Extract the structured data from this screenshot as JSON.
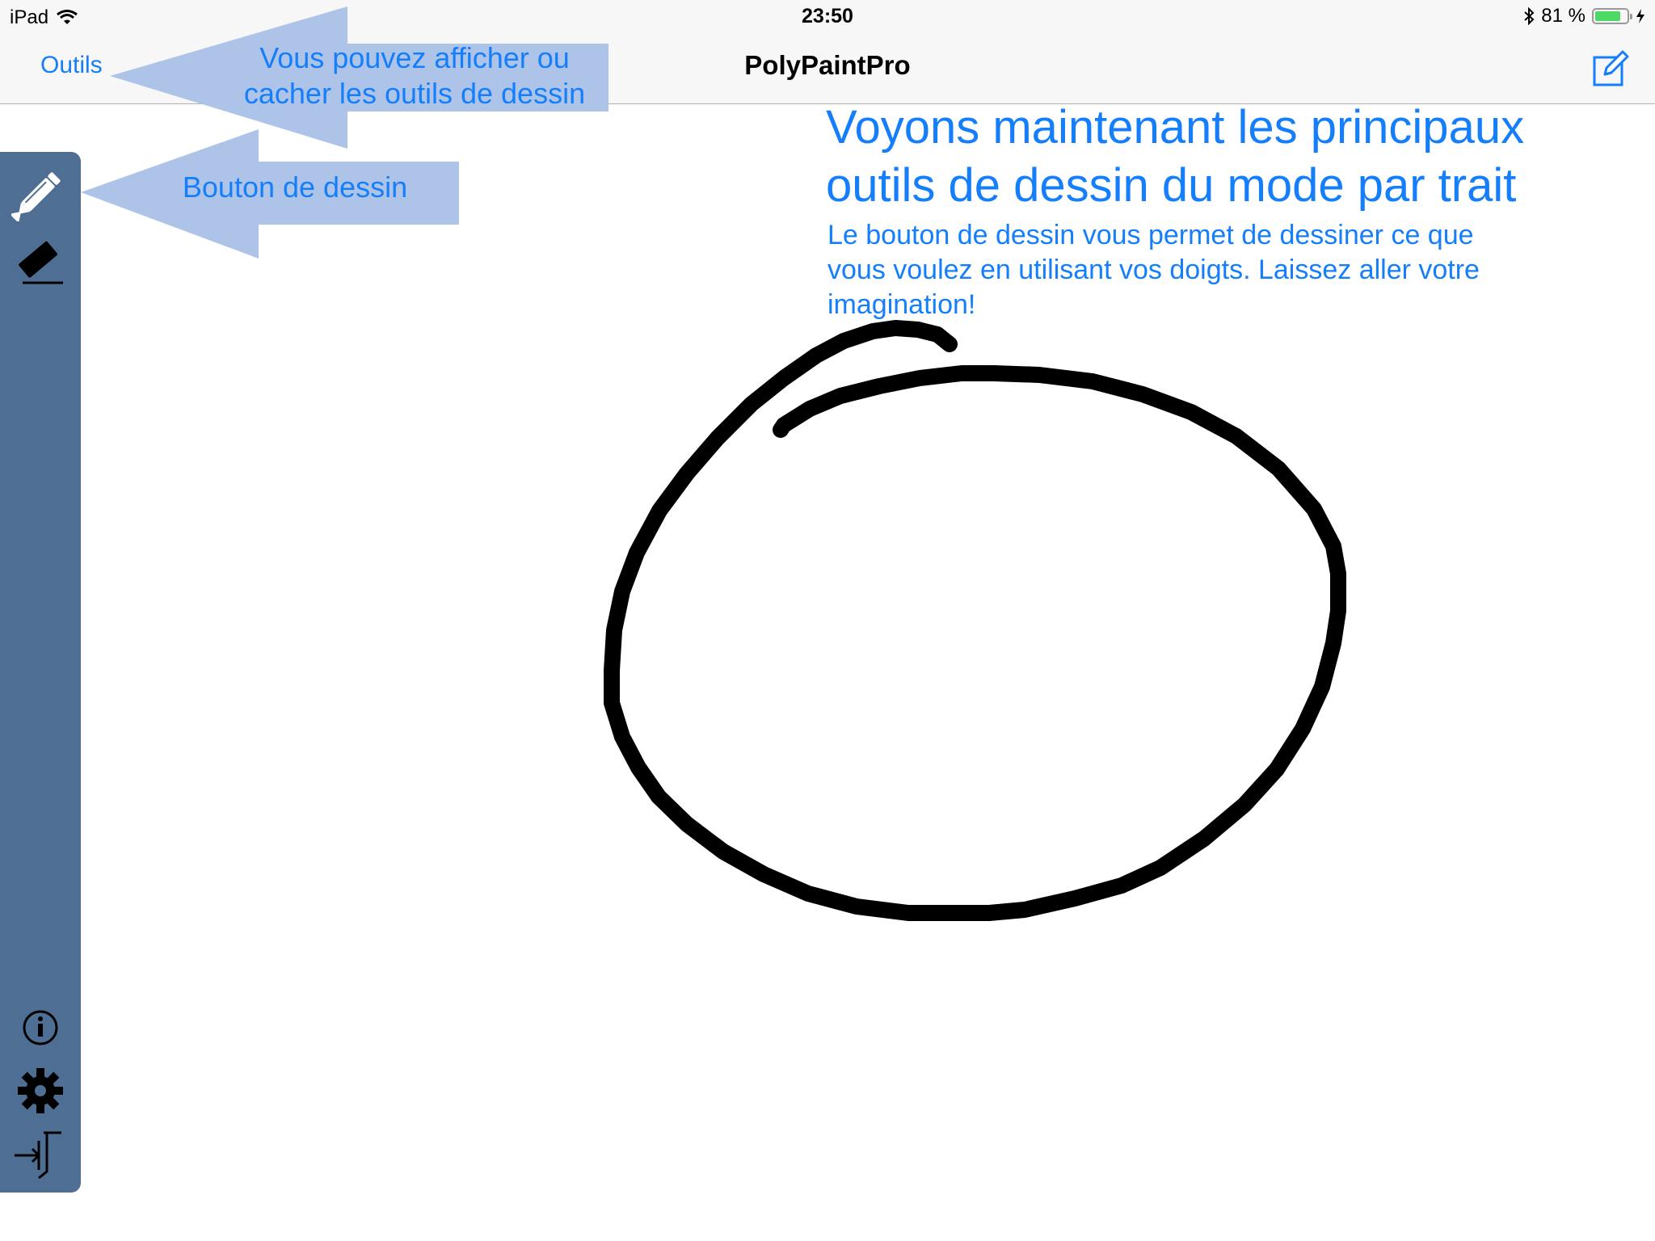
{
  "status_bar": {
    "device": "iPad",
    "time": "23:50",
    "battery_percent": "81 %",
    "battery_level": 0.81,
    "icons": [
      "wifi-icon",
      "bluetooth-icon",
      "battery-icon",
      "charging-icon"
    ]
  },
  "nav_bar": {
    "left_button": "Outils",
    "title": "PolyPaintPro",
    "right_icon": "compose-icon"
  },
  "sidebar": {
    "tools": [
      {
        "name": "pencil-icon",
        "label": "Dessin"
      },
      {
        "name": "eraser-icon",
        "label": "Efface"
      }
    ],
    "bottom": [
      {
        "name": "info-icon"
      },
      {
        "name": "gear-icon"
      },
      {
        "name": "exit-icon"
      }
    ]
  },
  "callouts": {
    "toolbar_toggle": "Vous pouvez afficher ou cacher les outils de dessin",
    "draw_button": "Bouton de dessin"
  },
  "tutorial": {
    "headline": "Voyons maintenant les principaux outils de dessin du mode par trait",
    "body": "Le bouton de dessin vous permet de dessiner ce que vous voulez en utilisant vos doigts. Laissez aller votre imagination!"
  },
  "colors": {
    "accent": "#157efb",
    "sidebar": "#4e6f93",
    "callout_fill": "#adc4e8",
    "stroke": "#000000"
  }
}
